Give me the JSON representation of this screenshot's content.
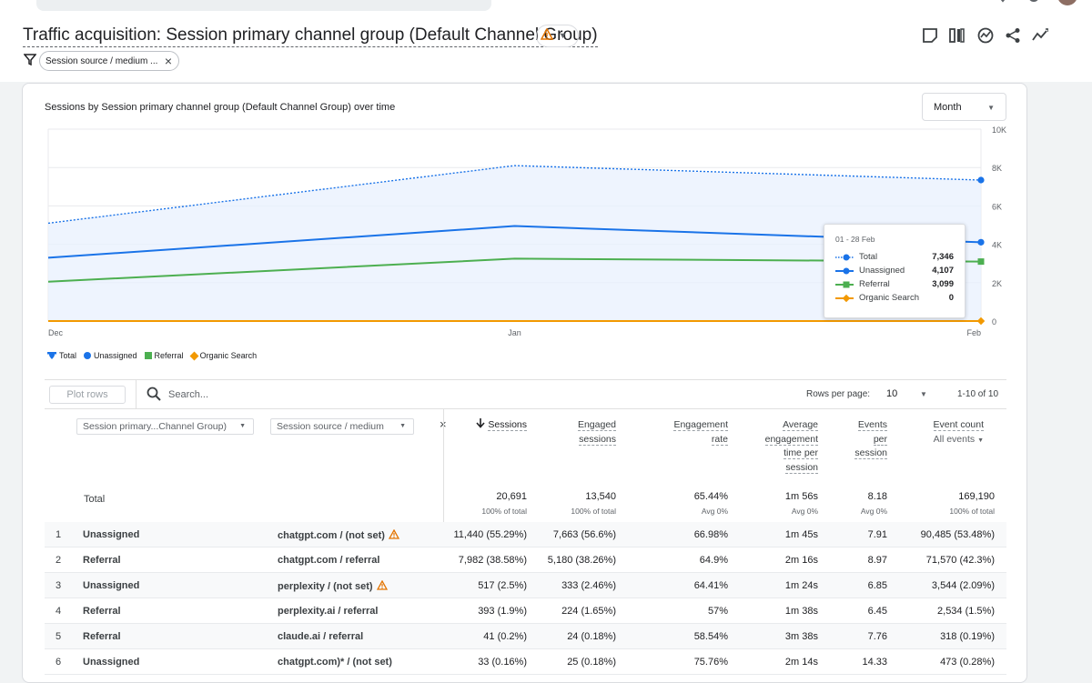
{
  "report": {
    "title": "Traffic acquisition: Session primary channel group (Default Channel Group)",
    "filter_chip": "Session source / medium ..."
  },
  "chart": {
    "title": "Sessions by Session primary channel group (Default Channel Group) over time",
    "period_select": "Month",
    "tooltip": {
      "date": "01 - 28 Feb",
      "rows": [
        {
          "name": "Total",
          "value": "7,346"
        },
        {
          "name": "Unassigned",
          "value": "4,107"
        },
        {
          "name": "Referral",
          "value": "3,099"
        },
        {
          "name": "Organic Search",
          "value": "0"
        }
      ]
    },
    "legend": [
      "Total",
      "Unassigned",
      "Referral",
      "Organic Search"
    ]
  },
  "chart_data": {
    "type": "line",
    "x": [
      "Dec",
      "Jan",
      "Feb"
    ],
    "series": [
      {
        "name": "Total",
        "values": [
          5100,
          8100,
          7346
        ]
      },
      {
        "name": "Unassigned",
        "values": [
          3300,
          4950,
          4107
        ]
      },
      {
        "name": "Referral",
        "values": [
          2050,
          3250,
          3099
        ]
      },
      {
        "name": "Organic Search",
        "values": [
          0,
          0,
          0
        ]
      }
    ],
    "y_ticks": [
      "10K",
      "8K",
      "6K",
      "4K",
      "2K",
      "0"
    ],
    "ylim": [
      0,
      10000
    ],
    "grid": true,
    "colors": {
      "Total": "#1a73e8",
      "Unassigned": "#1a73e8",
      "Referral": "#4caf50",
      "Organic Search": "#f29900"
    }
  },
  "table": {
    "plot_rows": "Plot rows",
    "search_placeholder": "Search...",
    "rows_per_page_label": "Rows per page:",
    "rows_per_page": "10",
    "pager": "1-10 of 10",
    "dim1": "Session primary...Channel Group)",
    "dim2": "Session source / medium",
    "headers": {
      "sessions": "Sessions",
      "engaged_1": "Engaged",
      "engaged_2": "sessions",
      "rate_1": "Engagement",
      "rate_2": "rate",
      "avg_1": "Average",
      "avg_2": "engagement",
      "avg_3": "time per",
      "avg_4": "session",
      "eps_1": "Events",
      "eps_2": "per",
      "eps_3": "session",
      "ec_1": "Event count",
      "ec_2": "All events"
    },
    "total_label": "Total",
    "totals": {
      "sessions": "20,691",
      "sessions_sub": "100% of total",
      "engaged": "13,540",
      "engaged_sub": "100% of total",
      "rate": "65.44%",
      "rate_sub": "Avg 0%",
      "avg": "1m 56s",
      "avg_sub": "Avg 0%",
      "eps": "8.18",
      "eps_sub": "Avg 0%",
      "ec": "169,190",
      "ec_sub": "100% of total"
    },
    "rows": [
      {
        "n": "1",
        "channel": "Unassigned",
        "source": "chatgpt.com / (not set)",
        "warn": true,
        "sessions": "11,440 (55.29%)",
        "engaged": "7,663 (56.6%)",
        "rate": "66.98%",
        "avg": "1m 45s",
        "eps": "7.91",
        "ec": "90,485 (53.48%)"
      },
      {
        "n": "2",
        "channel": "Referral",
        "source": "chatgpt.com / referral",
        "warn": false,
        "sessions": "7,982 (38.58%)",
        "engaged": "5,180 (38.26%)",
        "rate": "64.9%",
        "avg": "2m 16s",
        "eps": "8.97",
        "ec": "71,570 (42.3%)"
      },
      {
        "n": "3",
        "channel": "Unassigned",
        "source": "perplexity / (not set)",
        "warn": true,
        "sessions": "517 (2.5%)",
        "engaged": "333 (2.46%)",
        "rate": "64.41%",
        "avg": "1m 24s",
        "eps": "6.85",
        "ec": "3,544 (2.09%)"
      },
      {
        "n": "4",
        "channel": "Referral",
        "source": "perplexity.ai / referral",
        "warn": false,
        "sessions": "393 (1.9%)",
        "engaged": "224 (1.65%)",
        "rate": "57%",
        "avg": "1m 38s",
        "eps": "6.45",
        "ec": "2,534 (1.5%)"
      },
      {
        "n": "5",
        "channel": "Referral",
        "source": "claude.ai / referral",
        "warn": false,
        "sessions": "41 (0.2%)",
        "engaged": "24 (0.18%)",
        "rate": "58.54%",
        "avg": "3m 38s",
        "eps": "7.76",
        "ec": "318 (0.19%)"
      },
      {
        "n": "6",
        "channel": "Unassigned",
        "source": "chatgpt.com)* / (not set)",
        "warn": false,
        "sessions": "33 (0.16%)",
        "engaged": "25 (0.18%)",
        "rate": "75.76%",
        "avg": "2m 14s",
        "eps": "14.33",
        "ec": "473 (0.28%)"
      }
    ]
  }
}
